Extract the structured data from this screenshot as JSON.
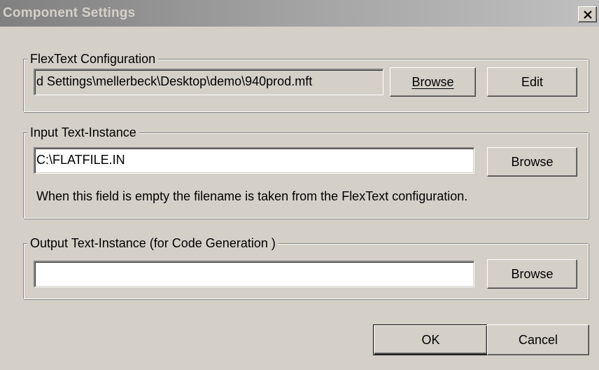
{
  "window": {
    "title": "Component Settings",
    "close_icon": "close-icon"
  },
  "flextext": {
    "legend": "FlexText Configuration",
    "path_value": "d Settings\\mellerbeck\\Desktop\\demo\\940prod.mft",
    "browse_label": "Browse",
    "edit_label": "Edit"
  },
  "input_instance": {
    "legend": "Input Text-Instance",
    "value": "C:\\FLATFILE.IN",
    "browse_label": "Browse",
    "hint": "When this field is empty the filename is taken from the FlexText configuration."
  },
  "output_instance": {
    "legend": "Output Text-Instance (for Code Generation )",
    "value": "",
    "browse_label": "Browse"
  },
  "footer": {
    "ok_label": "OK",
    "cancel_label": "Cancel"
  },
  "colors": {
    "face": "#d4d0c8",
    "titlebar_start": "#808080",
    "titlebar_end": "#c0c0c0",
    "text": "#000000"
  }
}
